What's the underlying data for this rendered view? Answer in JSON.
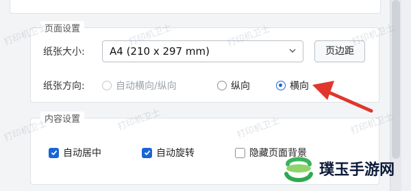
{
  "page_setup": {
    "title": "页面设置",
    "paper_size_label": "纸张大小:",
    "paper_size_value": "A4 (210 x 297 mm)",
    "margins_button": "页边距",
    "orientation_label": "纸张方向:",
    "orientation_options": [
      {
        "label": "自动横向/纵向",
        "state": "disabled"
      },
      {
        "label": "纵向",
        "state": "unchecked"
      },
      {
        "label": "横向",
        "state": "checked"
      }
    ]
  },
  "content_settings": {
    "title": "内容设置",
    "options": [
      {
        "label": "自动居中",
        "checked": true
      },
      {
        "label": "自动旋转",
        "checked": true
      },
      {
        "label": "隐藏页面背景",
        "checked": false
      }
    ]
  },
  "watermark": {
    "text": "打印机卫士"
  },
  "site_logo": {
    "text": "璞玉手游网"
  },
  "colors": {
    "accent": "#1b64d6",
    "arrow": "#e0362c"
  }
}
